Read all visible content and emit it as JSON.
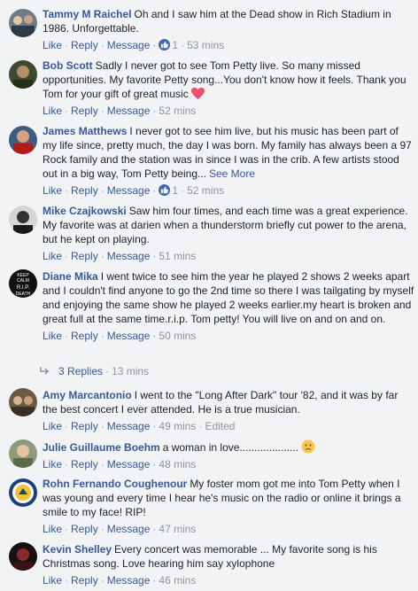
{
  "comments": [
    {
      "name": "Tammy M Raichel",
      "text": "Oh and I saw him at the Dead show in Rich Stadium in 1986. Unforgettable.",
      "like": "Like",
      "reply": "Reply",
      "message": "Message",
      "reaction_count": "1",
      "time": "53 mins"
    },
    {
      "name": "Bob Scott",
      "text": "Sadly I never got to see Tom Petty live. So many missed opportunities. My favorite Petty song...You don't know how it feels. Thank you Tom for your gift of great music",
      "like": "Like",
      "reply": "Reply",
      "message": "Message",
      "time": "52 mins"
    },
    {
      "name": "James Matthews",
      "text": "I never got to see him live, but his music has been part of my life since, pretty much, the day I was born. My family has always been a 97 Rock family and the station was in since I was in the crib. A few artists stood out in a big way, Tom Petty being...",
      "see_more": "See More",
      "like": "Like",
      "reply": "Reply",
      "message": "Message",
      "reaction_count": "1",
      "time": "52 mins"
    },
    {
      "name": "Mike Czajkowski",
      "text": "Saw him four times, and each time was a great experience. My favorite was at darien when a thunderstorm briefly cut power to the arena, but he kept on playing.",
      "like": "Like",
      "reply": "Reply",
      "message": "Message",
      "time": "51 mins"
    },
    {
      "name": "Diane Mika",
      "text": "I went twice to see him the year he played 2 shows 2 weeks apart and I couldn't find anyone to go the 2nd time so there I was tailgating by myself and enjoying the same show he played 2 weeks earlier.my heart is broken and great full at the same time.r.i.p. Tom petty! You will live on and on and on.",
      "like": "Like",
      "reply": "Reply",
      "message": "Message",
      "time": "50 mins",
      "avatar_text": [
        "KEEP",
        "CALM",
        "R.I.P.",
        "DEATH"
      ]
    },
    {
      "name": "Amy Marcantonio",
      "text": "I went to the \"Long After Dark\" tour '82, and it was by far the best concert I ever attended. He is a true musician.",
      "like": "Like",
      "reply": "Reply",
      "message": "Message",
      "time": "49 mins",
      "edited": "Edited"
    },
    {
      "name": "Julie Guillaume Boehm",
      "text": "a woman in love....................",
      "like": "Like",
      "reply": "Reply",
      "message": "Message",
      "time": "48 mins"
    },
    {
      "name": "Rohn Fernando Coughenour",
      "text": "My foster mom got me into Tom Petty when I was young and every time I hear he's music on the radio or online it brings a smile to my face! RIP!",
      "like": "Like",
      "reply": "Reply",
      "message": "Message",
      "time": "47 mins"
    },
    {
      "name": "Kevin Shelley",
      "text": "Every concert was memorable ... My favorite song is his Christmas song. Love hearing him say xylophone",
      "like": "Like",
      "reply": "Reply",
      "message": "Message",
      "time": "46 mins"
    }
  ],
  "replies_link": {
    "label": "3 Replies",
    "time": "13 mins"
  },
  "colors": {
    "link": "#385898",
    "meta": "#90949c",
    "text": "#1d2129",
    "background": "#f2f3f5",
    "like_badge": "#4267b2",
    "heart": "#f0506e"
  },
  "icons": {
    "like_reaction": "thumbs-up-icon",
    "heart": "heart-emoji-icon",
    "emoji": "slightly-sad-face-icon",
    "reply_arrow": "reply-arrow-icon"
  }
}
